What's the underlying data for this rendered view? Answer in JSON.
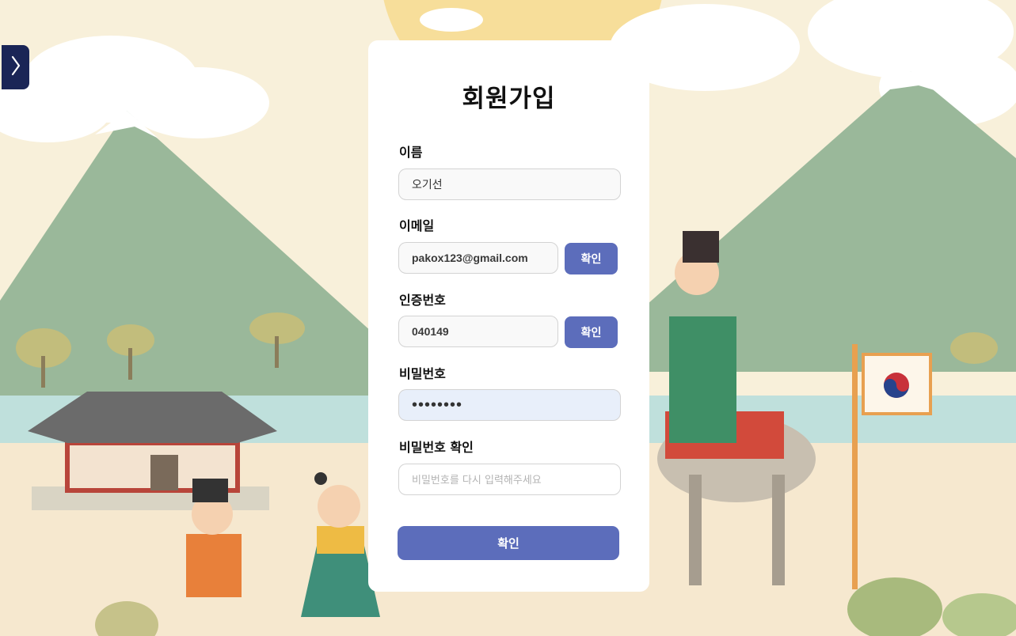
{
  "sidebar": {
    "toggle_icon": "chevron-right-icon"
  },
  "signup": {
    "title": "회원가입",
    "name": {
      "label": "이름",
      "value": "오기선"
    },
    "email": {
      "label": "이메일",
      "value": "pakox123@gmail.com",
      "button": "확인"
    },
    "verification": {
      "label": "인증번호",
      "value": "040149",
      "button": "확인"
    },
    "password": {
      "label": "비밀번호",
      "value": "••••••••"
    },
    "password_confirm": {
      "label": "비밀번호 확인",
      "placeholder": "비밀번호를 다시 입력해주세요"
    },
    "submit": "확인"
  },
  "colors": {
    "accent": "#5c6dbb",
    "sidebar_toggle": "#1a2556",
    "autofill_bg": "#e8effa"
  }
}
